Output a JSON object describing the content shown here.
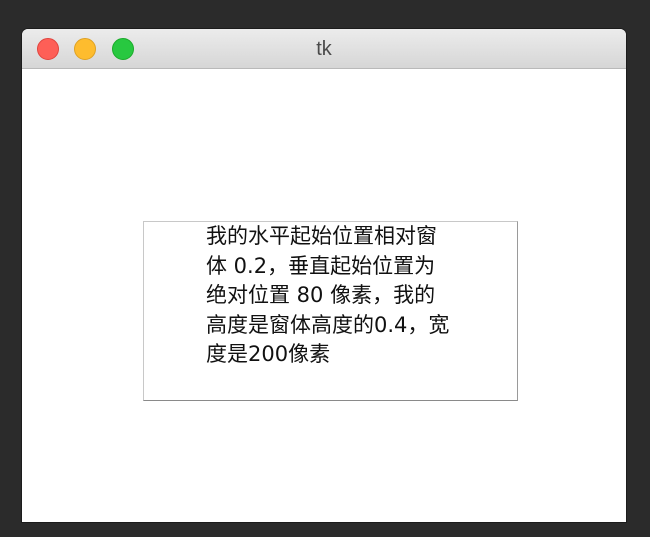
{
  "window": {
    "title": "tk"
  },
  "titlebar": {
    "buttons": [
      "close",
      "minimize",
      "zoom"
    ]
  },
  "label": {
    "text": "我的水平起始位置相对窗体 0.2，垂直起始位置为绝对位置 80 像素，我的高度是窗体高度的0.4，宽度是200像素"
  },
  "colors": {
    "close": "#fe5f57",
    "minimize": "#febc2e",
    "zoom": "#28c840",
    "background": "#ffffff"
  }
}
